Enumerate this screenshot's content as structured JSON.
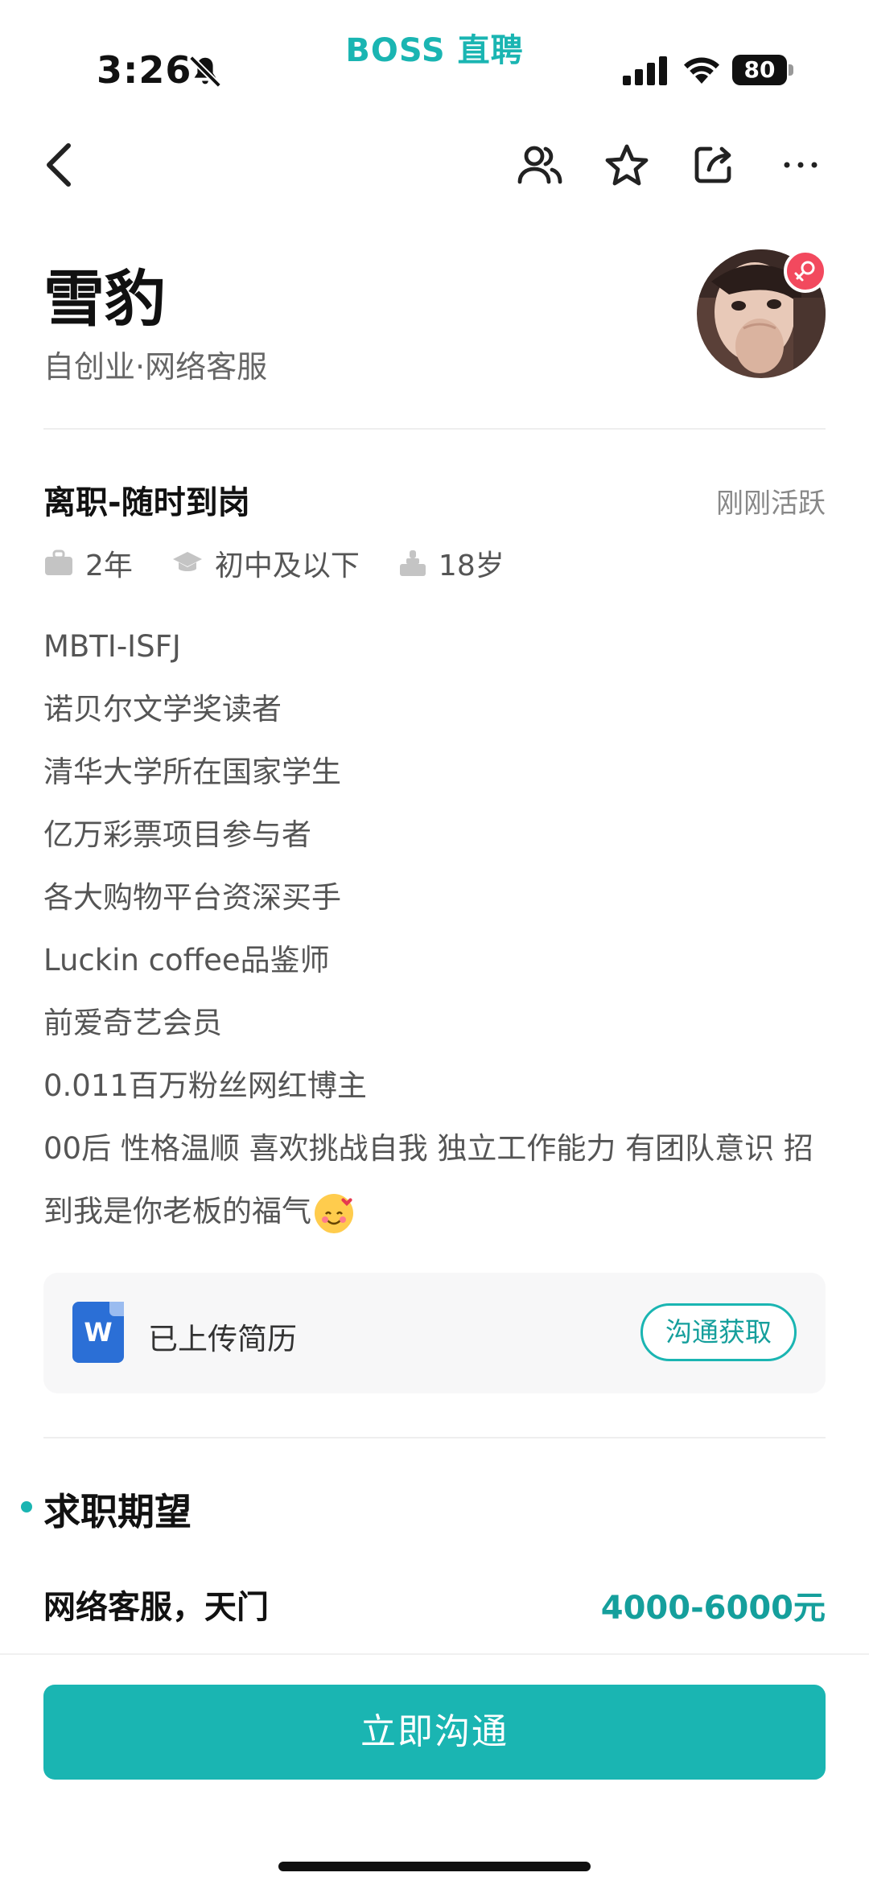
{
  "status_bar": {
    "time": "3:26",
    "app_brand": "BOSS 直聘",
    "battery": "80"
  },
  "profile": {
    "name": "雪豹",
    "subtitle": "自创业·网络客服",
    "job_status": "离职-随时到岗",
    "active_status": "刚刚活跃",
    "experience": "2年",
    "education": "初中及以下",
    "age": "18岁"
  },
  "bio": {
    "lines": [
      "MBTI-ISFJ",
      "诺贝尔文学奖读者",
      "清华大学所在国家学生",
      "亿万彩票项目参与者",
      "各大购物平台资深买手",
      "Luckin coffee品鉴师",
      "前爱奇艺会员",
      "0.011百万粉丝网红博主"
    ],
    "paragraph": "00后 性格温顺 喜欢挑战自我 独立工作能力 有团队意识 招到我是你老板的福气"
  },
  "resume": {
    "icon_letter": "W",
    "label": "已上传简历",
    "button": "沟通获取"
  },
  "expectation": {
    "section_title": "求职期望",
    "job": "网络客服，天门",
    "salary": "4000-6000元"
  },
  "bottom": {
    "chat_button": "立即沟通"
  },
  "colors": {
    "brand": "#1ab5b2",
    "salary": "#159f9c",
    "gender_badge": "#f2495e",
    "word_icon": "#2b6fd6"
  },
  "icons": [
    "back-icon",
    "people-icon",
    "star-icon",
    "share-icon",
    "more-icon",
    "briefcase-icon",
    "graduation-cap-icon",
    "age-icon",
    "word-doc-icon",
    "female-icon"
  ]
}
